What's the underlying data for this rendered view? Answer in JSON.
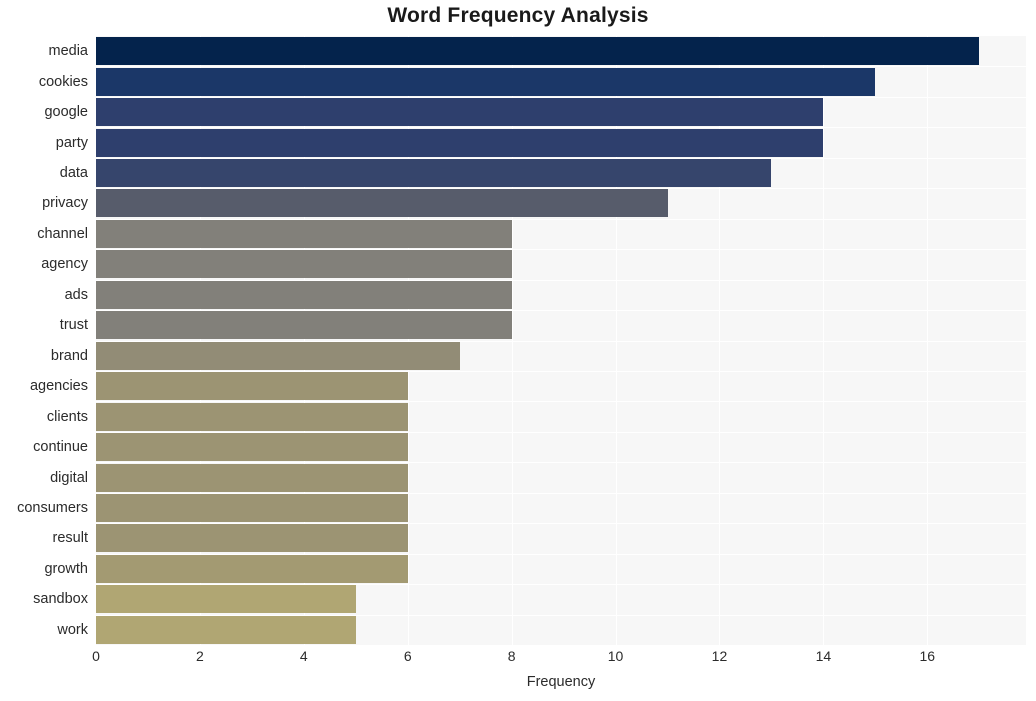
{
  "chart_data": {
    "type": "bar",
    "orientation": "horizontal",
    "title": "Word Frequency Analysis",
    "xlabel": "Frequency",
    "ylabel": "",
    "categories": [
      "media",
      "cookies",
      "google",
      "party",
      "data",
      "privacy",
      "channel",
      "agency",
      "ads",
      "trust",
      "brand",
      "agencies",
      "clients",
      "continue",
      "digital",
      "consumers",
      "result",
      "growth",
      "sandbox",
      "work"
    ],
    "values": [
      17,
      15,
      14,
      14,
      13,
      11,
      8,
      8,
      8,
      8,
      7,
      6,
      6,
      6,
      6,
      6,
      6,
      6,
      5,
      5
    ],
    "bar_colors": [
      "#04234c",
      "#1b3768",
      "#2e3f6d",
      "#2e3f6d",
      "#36456c",
      "#575c6b",
      "#82807a",
      "#82807a",
      "#82807a",
      "#82807a",
      "#928c76",
      "#9c9473",
      "#9c9473",
      "#9c9473",
      "#9c9473",
      "#9c9473",
      "#9c9473",
      "#a39a72",
      "#b0a673",
      "#b0a673"
    ],
    "xlim": [
      0,
      17.9
    ],
    "xticks": [
      0,
      2,
      4,
      6,
      8,
      10,
      12,
      14,
      16
    ],
    "xtick_labels": [
      "0",
      "2",
      "4",
      "6",
      "8",
      "10",
      "12",
      "14",
      "16"
    ],
    "grid": true,
    "grid_color": "#ffffff",
    "plot_background": "#f7f7f7",
    "figure_background": "#ffffff",
    "legend": null
  }
}
